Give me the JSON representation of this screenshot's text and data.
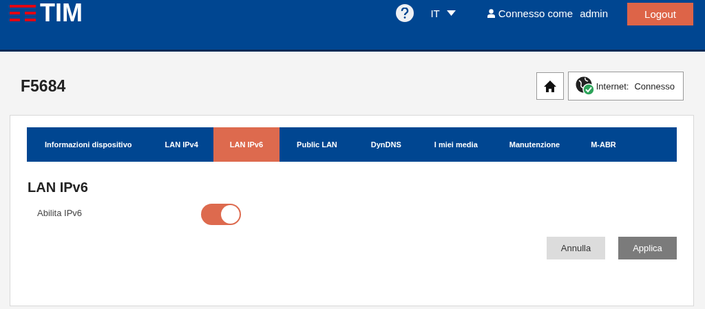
{
  "header": {
    "logo_text": "TIM",
    "language": "IT",
    "user_label": "Connesso come",
    "user_name": "admin",
    "logout": "Logout"
  },
  "device": {
    "title": "F5684",
    "internet_label": "Internet:",
    "internet_status": "Connesso"
  },
  "tabs": [
    {
      "label": "Informazioni dispositivo",
      "selected": false
    },
    {
      "label": "LAN IPv4",
      "selected": false
    },
    {
      "label": "LAN IPv6",
      "selected": true
    },
    {
      "label": "Public LAN",
      "selected": false
    },
    {
      "label": "DynDNS",
      "selected": false
    },
    {
      "label": "I miei media",
      "selected": false
    },
    {
      "label": "Manutenzione",
      "selected": false
    },
    {
      "label": "M-ABR",
      "selected": false
    }
  ],
  "section": {
    "title": "LAN IPv6",
    "settings": [
      {
        "label": "Abilita IPv6",
        "on": true
      }
    ]
  },
  "buttons": [
    {
      "label": "Annulla",
      "kind": "secondary"
    },
    {
      "label": "Applica",
      "kind": "primary"
    }
  ]
}
